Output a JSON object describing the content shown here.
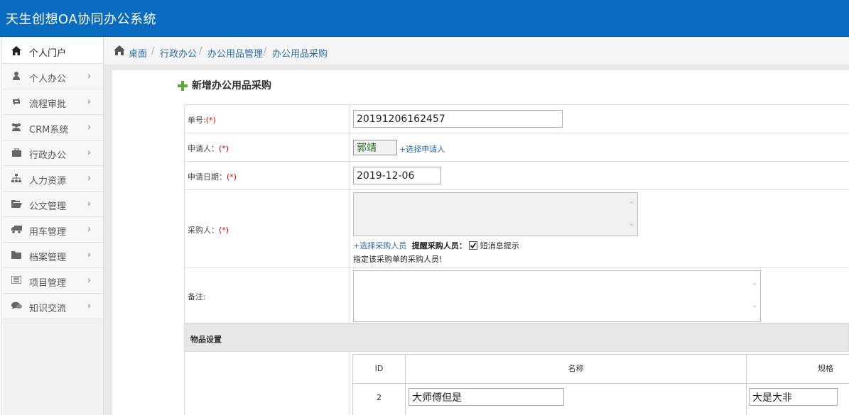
{
  "app": {
    "title": "天生创想OA协同办公系统"
  },
  "sidebar": {
    "items": [
      {
        "label": "个人门户",
        "icon": "home-icon"
      },
      {
        "label": "个人办公",
        "icon": "user-icon"
      },
      {
        "label": "流程审批",
        "icon": "retweet-icon"
      },
      {
        "label": "CRM系统",
        "icon": "group-icon"
      },
      {
        "label": "行政办公",
        "icon": "briefcase-icon"
      },
      {
        "label": "人力资源",
        "icon": "sitemap-icon"
      },
      {
        "label": "公文管理",
        "icon": "folder-open-icon"
      },
      {
        "label": "用车管理",
        "icon": "truck-icon"
      },
      {
        "label": "档案管理",
        "icon": "folder-icon"
      },
      {
        "label": "项目管理",
        "icon": "list-icon"
      },
      {
        "label": "知识交流",
        "icon": "comments-icon"
      }
    ],
    "chevron": "›"
  },
  "breadcrumb": {
    "items": [
      "桌面",
      "行政办公",
      "办公用品管理",
      "办公用品采购"
    ],
    "sep": "/"
  },
  "form": {
    "title": "新增办公用品采购",
    "req_mark": "(*)",
    "number": {
      "label": "单号:",
      "value": "20191206162457"
    },
    "applicant": {
      "label": "申请人：",
      "value": "郭靖",
      "link": "+选择申请人"
    },
    "date": {
      "label": "申请日期：",
      "value": "2019-12-06"
    },
    "buyer": {
      "label": "采购人：",
      "link": "+选择采购人员",
      "remind_label": "提醒采购人员：",
      "sms_label": "短消息提示",
      "sms_checked": true,
      "hint": "指定该采购单的采购人员!"
    },
    "remark": {
      "label": "备注:"
    }
  },
  "items_section": {
    "title": "物品设置",
    "headers": [
      "ID",
      "名称",
      "规格"
    ],
    "rows": [
      {
        "id": "2",
        "name": "大师傅但是",
        "spec": "大是大非"
      }
    ]
  }
}
